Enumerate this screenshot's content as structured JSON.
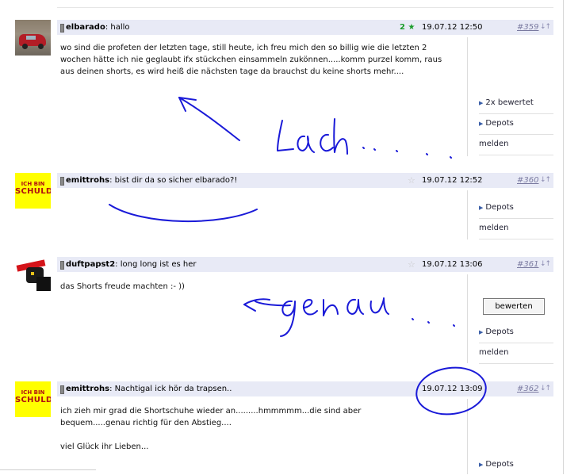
{
  "posts": [
    {
      "user": "elbarado",
      "title": ": hallo",
      "rating": "2",
      "time": "19.07.12 12:50",
      "num": "#359",
      "text": "wo sind die profeten der letzten tage, still heute, ich freu mich den so billig wie die letzten 2 wochen hätte ich nie geglaubt ifx stückchen einsammeln zukönnen.....komm purzel komm, raus aus deinen shorts, es wird heiß die nächsten tage da brauchst du keine shorts mehr...."
    },
    {
      "user": "emittrohs",
      "title": ": bist dir da so sicher elbarado?!",
      "time": "19.07.12 12:52",
      "num": "#360",
      "text": ""
    },
    {
      "user": "duftpapst2",
      "title": ": long long ist es her",
      "time": "19.07.12 13:06",
      "num": "#361",
      "text": "das Shorts freude machten :- ))"
    },
    {
      "user": "emittrohs",
      "title": ": Nachtigal ick hör da trapsen..",
      "time": "19.07.12 13:09",
      "num": "#362",
      "text_lines": [
        "ich zieh mir grad die Shortschuhe wieder an.........hmmmmm...die sind aber bequem.....genau richtig für den Abstieg....",
        "viel Glück ihr Lieben..."
      ]
    }
  ],
  "sidebar": {
    "rated": "2x bewertet",
    "depots": "Depots",
    "report": "melden",
    "rate_button": "bewerten"
  },
  "avatars": {
    "schuld_line1": "ICH BIN",
    "schuld_line2": "SCHULD"
  },
  "icons": {
    "star_filled": "★",
    "star_empty": "☆",
    "sort_arrows": "↓↑",
    "bullet": "▶"
  },
  "colors": {
    "header_bg": "#e8eaf6",
    "ink": "#1a1ad8",
    "star_green": "#1a9c2a",
    "schuld_bg": "#ffff00"
  }
}
